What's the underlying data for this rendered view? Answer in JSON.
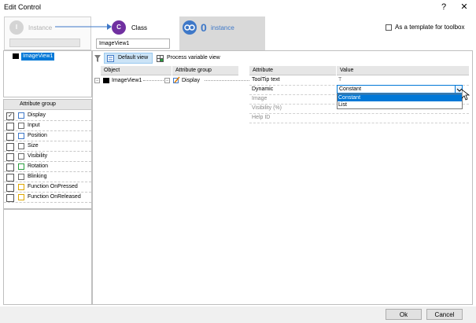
{
  "window": {
    "title": "Edit Control",
    "help": "?",
    "close": "✕"
  },
  "top": {
    "instance_label": "Instance",
    "class_label": "Class",
    "class_circle": "C",
    "instance_circle": "I",
    "count_value": "0",
    "count_label": "instance",
    "class_name_field": "ImageView1",
    "template_checkbox_label": "As a template for toolbox",
    "template_checked": false
  },
  "tree": {
    "root_label": "ImageView1"
  },
  "attr_group": {
    "header": "Attribute group",
    "items": [
      {
        "label": "Display",
        "checked": true
      },
      {
        "label": "Input",
        "checked": false
      },
      {
        "label": "Position",
        "checked": false
      },
      {
        "label": "Size",
        "checked": false
      },
      {
        "label": "Visibility",
        "checked": false
      },
      {
        "label": "Rotation",
        "checked": false
      },
      {
        "label": "Blinking",
        "checked": false
      },
      {
        "label": "Function OnPressed",
        "checked": false
      },
      {
        "label": "Function OnReleased",
        "checked": false
      }
    ]
  },
  "toolbar": {
    "default_view": "Default view",
    "process_view": "Process variable view"
  },
  "grid": {
    "headers": {
      "object": "Object",
      "attr_group": "Attribute group",
      "attribute": "Attribute",
      "value": "Value"
    },
    "object_row": {
      "name": "ImageView1",
      "group": "Display"
    },
    "attributes": [
      {
        "name": "ToolTip text",
        "value": "T"
      },
      {
        "name": "Dynamic",
        "value": "Constant"
      },
      {
        "name": "Image",
        "value": ""
      },
      {
        "name": "Visibility (%)",
        "value": ""
      },
      {
        "name": "Help ID",
        "value": ""
      }
    ],
    "dropdown_options": [
      "Constant",
      "List"
    ]
  },
  "footer": {
    "ok": "Ok",
    "cancel": "Cancel"
  },
  "colors": {
    "class_purple": "#7030a0",
    "instance_blue": "#3e78c8",
    "selection": "#0078d7",
    "grey_panel": "#d9d9d9"
  }
}
